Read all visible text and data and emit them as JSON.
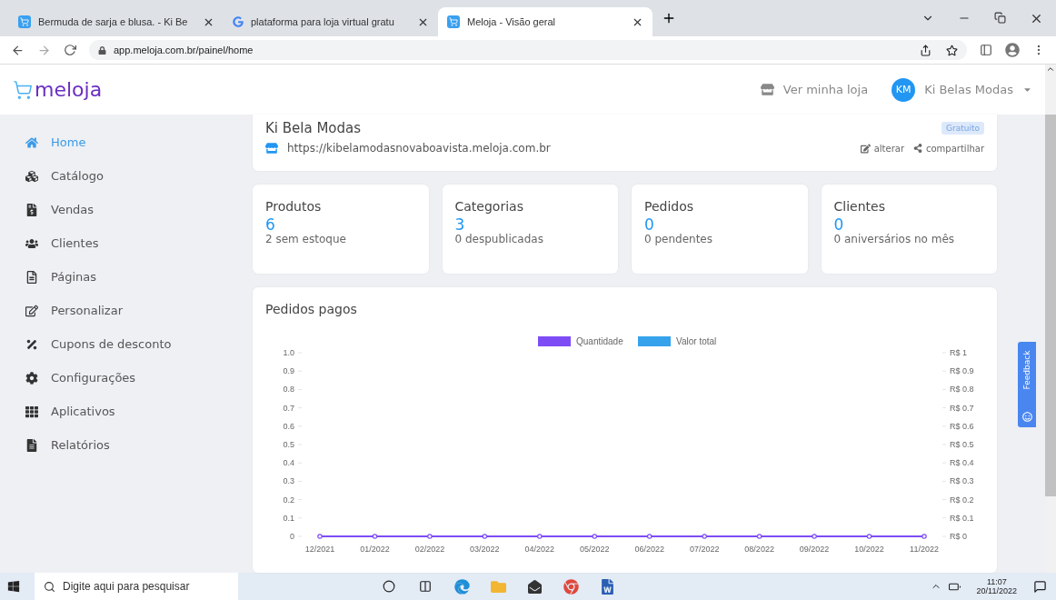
{
  "browser": {
    "tabs": [
      {
        "title": "Bermuda de sarja e blusa. - Ki Be",
        "selected": false
      },
      {
        "title": "plataforma para loja virtual gratu",
        "selected": false
      },
      {
        "title": "Meloja - Visão geral",
        "selected": true
      }
    ],
    "url": "app.meloja.com.br/painel/home"
  },
  "header": {
    "logo": "meloja",
    "store_link": "Ver minha loja",
    "avatar": "KM",
    "user": "Ki Belas Modas"
  },
  "sidebar": {
    "items": [
      {
        "label": "Home",
        "selected": true
      },
      {
        "label": "Catálogo",
        "selected": false
      },
      {
        "label": "Vendas",
        "selected": false
      },
      {
        "label": "Clientes",
        "selected": false
      },
      {
        "label": "Páginas",
        "selected": false
      },
      {
        "label": "Personalizar",
        "selected": false
      },
      {
        "label": "Cupons de desconto",
        "selected": false
      },
      {
        "label": "Configurações",
        "selected": false
      },
      {
        "label": "Aplicativos",
        "selected": false
      },
      {
        "label": "Relatórios",
        "selected": false
      }
    ]
  },
  "store": {
    "name": "Ki Bela Modas",
    "plan": "Gratuito",
    "url": "https://kibelamodasnovaboavista.meloja.com.br",
    "edit": "alterar",
    "share": "compartilhar"
  },
  "stats": [
    {
      "title": "Produtos",
      "value": "6",
      "note": "2 sem estoque"
    },
    {
      "title": "Categorias",
      "value": "3",
      "note": "0 despublicadas"
    },
    {
      "title": "Pedidos",
      "value": "0",
      "note": "0 pendentes"
    },
    {
      "title": "Clientes",
      "value": "0",
      "note": "0 aniversários no mês"
    }
  ],
  "orders_chart": {
    "title": "Pedidos pagos",
    "right_axis_labels": [
      "R$ 1",
      "R$ 0.9",
      "R$ 0.8",
      "R$ 0.7",
      "R$ 0.6",
      "R$ 0.5",
      "R$ 0.4",
      "R$ 0.3",
      "R$ 0.2",
      "R$ 0.1",
      "R$ 0"
    ],
    "chart_data": {
      "type": "line",
      "legend": "top",
      "categories": [
        "12/2021",
        "01/2022",
        "02/2022",
        "03/2022",
        "04/2022",
        "05/2022",
        "06/2022",
        "07/2022",
        "08/2022",
        "09/2022",
        "10/2022",
        "11/2022"
      ],
      "series": [
        {
          "name": "Quantidade",
          "color": "#7e4cf5",
          "marker": "circle",
          "values": [
            0,
            0,
            0,
            0,
            0,
            0,
            0,
            0,
            0,
            0,
            0,
            0
          ]
        },
        {
          "name": "Valor total",
          "color": "#36a2eb",
          "values": [
            null,
            null,
            null,
            null,
            null,
            null,
            null,
            null,
            null,
            null,
            null,
            null
          ]
        }
      ],
      "ylim": [
        0,
        1
      ],
      "yticks": [
        0,
        0.1,
        0.2,
        0.3,
        0.4,
        0.5,
        0.6,
        0.7,
        0.8,
        0.9,
        {
          "value": 1,
          "label": "1.0"
        }
      ]
    }
  },
  "feedback": "Feedback",
  "taskbar": {
    "search_placeholder": "Digite aqui para pesquisar",
    "time": "11:07",
    "date": "20/11/2022"
  }
}
